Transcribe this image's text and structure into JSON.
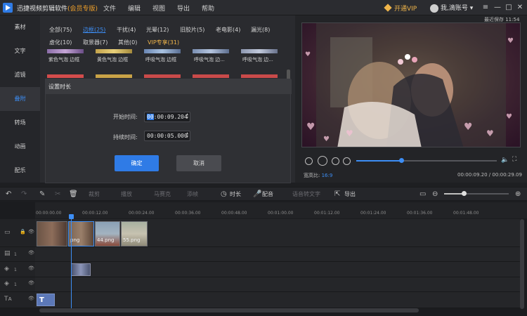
{
  "titlebar": {
    "app_name": "迅捷视频剪辑软件",
    "edition": "(会员专版)",
    "menus": [
      "文件",
      "编辑",
      "视图",
      "导出",
      "帮助"
    ],
    "vip": "开通VIP",
    "account": "我,滴账号"
  },
  "window_controls": {
    "menu": "≡",
    "minimize": "—",
    "maximize": "□",
    "close": "✕"
  },
  "leftnav": [
    "素材",
    "文字",
    "滤镜",
    "叠附",
    "转场",
    "动画",
    "配乐"
  ],
  "library": {
    "categories_row1": [
      "全部(75)",
      "边框(25)",
      "干扰(4)",
      "光晕(12)",
      "旧胶片(5)",
      "老电影(4)",
      "漏光(8)"
    ],
    "categories_row2": [
      "虚化(10)",
      "取景器(7)",
      "其他(0)",
      "VIP专享(31)"
    ],
    "active_category": "边框(25)",
    "thumbs": [
      "紫色气泡 边框",
      "黄色气泡 边框",
      "呼吸气泡 边框",
      "呼吸气泡 边...",
      "呼吸气泡 边..."
    ]
  },
  "dialog": {
    "title": "设置时长",
    "start_label": "开始时间:",
    "start_hl": "00",
    "start_rest": ":00:09.204",
    "duration_label": "持续时间:",
    "duration_value": "00:00:05.000",
    "ok": "确定",
    "cancel": "取消"
  },
  "preview": {
    "saved": "最近保存 11:54",
    "aspect_label": "宽高比:",
    "aspect_value": "16:9",
    "timecode": "00:00:09.20 / 00:00:29.09",
    "progress": 0.32
  },
  "toolbar": {
    "crop": "裁剪",
    "speed": "播放",
    "mosaic": "马赛克",
    "freeze": "添帧",
    "duration": "时长",
    "dub": "配音",
    "speech": "语音转文字",
    "export": "导出",
    "zoom": 0.3
  },
  "ruler": [
    "00:00:00.00",
    "00:00:12.00",
    "00:00:24.00",
    "00:00:36.00",
    "00:00:48.00",
    "00:01:00.00",
    "00:01:12.00",
    "00:01:24.00",
    "00:01:36.00",
    "00:01:48.00"
  ],
  "tracks": {
    "numbers": [
      "1",
      "1",
      "1"
    ],
    "clips": [
      "png",
      "44.png",
      "55.png"
    ],
    "text_clip": "T"
  },
  "colors": {
    "accent": "#2f7be6",
    "vip": "#f0b54a",
    "bg": "#1e1f22"
  }
}
